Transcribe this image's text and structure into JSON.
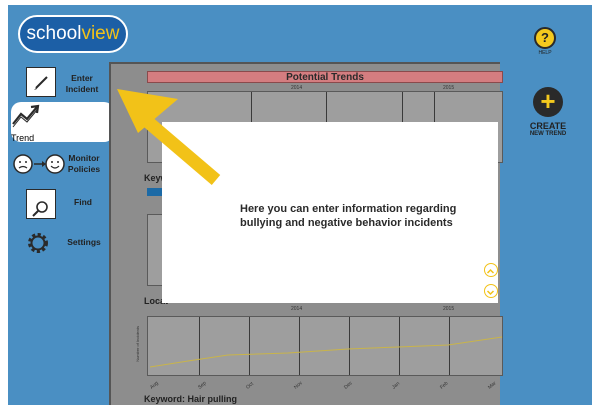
{
  "app": {
    "logo_part1": "school",
    "logo_part2": "view",
    "help_label": "HELP",
    "help_symbol": "?"
  },
  "sidebar": {
    "items": [
      {
        "label": "Enter Incident",
        "icon": "pencil-paper-icon"
      },
      {
        "label": "Trend",
        "icon": "trend-line-icon",
        "selected": true
      },
      {
        "label": "Monitor Policies",
        "icon": "face-monitor-icon"
      },
      {
        "label": "Find",
        "icon": "magnify-paper-icon"
      },
      {
        "label": "Settings",
        "icon": "gear-icon"
      }
    ]
  },
  "main": {
    "title": "Potential Trends",
    "years": [
      "2014",
      "2015"
    ],
    "keyword_prefix": "Keyw",
    "location_prefix": "Locat",
    "bottom_keyword": "Keyword: Hair pulling",
    "y_axis_label": "Number of Incidents",
    "months": [
      "Aug",
      "Sep",
      "Oct",
      "Nov",
      "Dec",
      "Jan",
      "Feb",
      "Mar"
    ]
  },
  "create": {
    "line1": "CREATE",
    "line2": "NEW TREND"
  },
  "popup": {
    "message": "Here you can enter information regarding bullying and negative behavior incidents",
    "up_symbol": "⌃",
    "down_symbol": "⌄"
  },
  "colors": {
    "background": "#4a8fc3",
    "accent_yellow": "#f2c218",
    "title_bar": "#d47d80",
    "chart_panel": "#8d8d8d"
  }
}
